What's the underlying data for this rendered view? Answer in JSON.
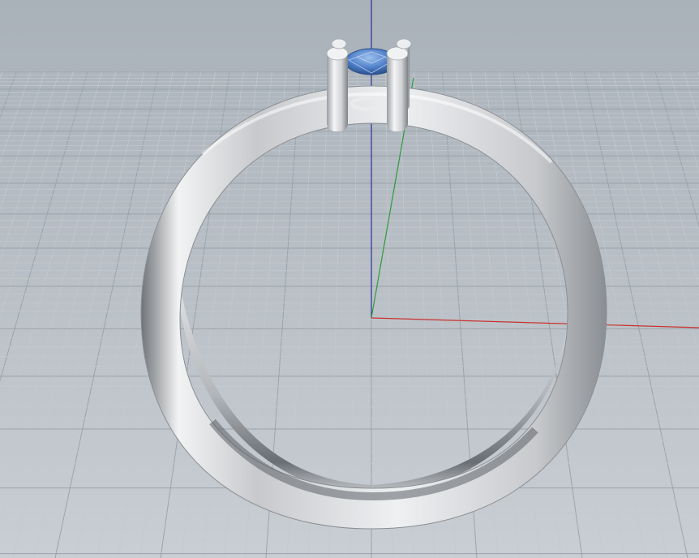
{
  "viewport": {
    "background_top": "#a9b1b9",
    "background_bottom": "#c9ced3",
    "grid_minor_color": "#c3c9cf",
    "grid_major_color": "#9aa3ac",
    "axis_x_color": "#c8322e",
    "axis_y_color": "#2f9a3a",
    "axis_z_color": "#2d2f9a"
  },
  "model": {
    "metal_light": "#f2f3f4",
    "metal_mid": "#c7c9cc",
    "metal_dark": "#6f7378",
    "gem_light": "#9ec1ef",
    "gem_mid": "#4f7fc8",
    "gem_dark": "#24477f"
  }
}
